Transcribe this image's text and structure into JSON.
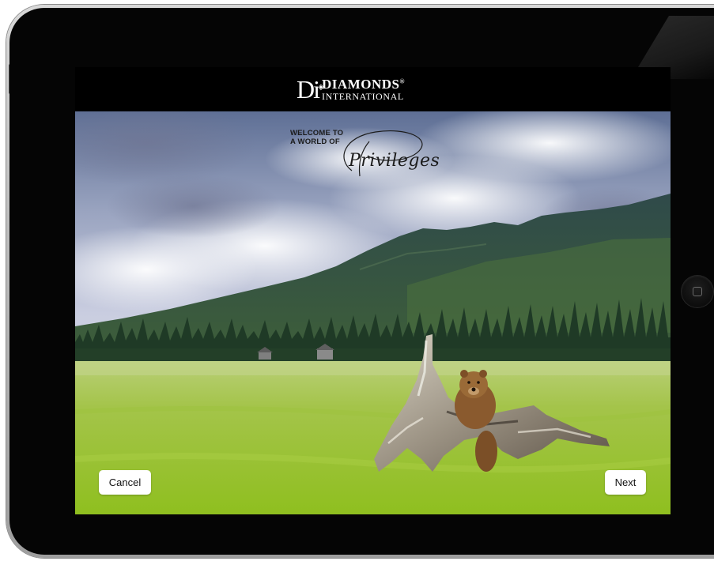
{
  "brand": {
    "logo_mark": "Di",
    "name_line1": "DIAMONDS",
    "registered": "®",
    "name_line2": "INTERNATIONAL"
  },
  "hero": {
    "welcome_line1": "WELCOME TO",
    "welcome_line2": "A WORLD OF",
    "script_word": "Privileges"
  },
  "actions": {
    "cancel_label": "Cancel",
    "next_label": "Next"
  }
}
